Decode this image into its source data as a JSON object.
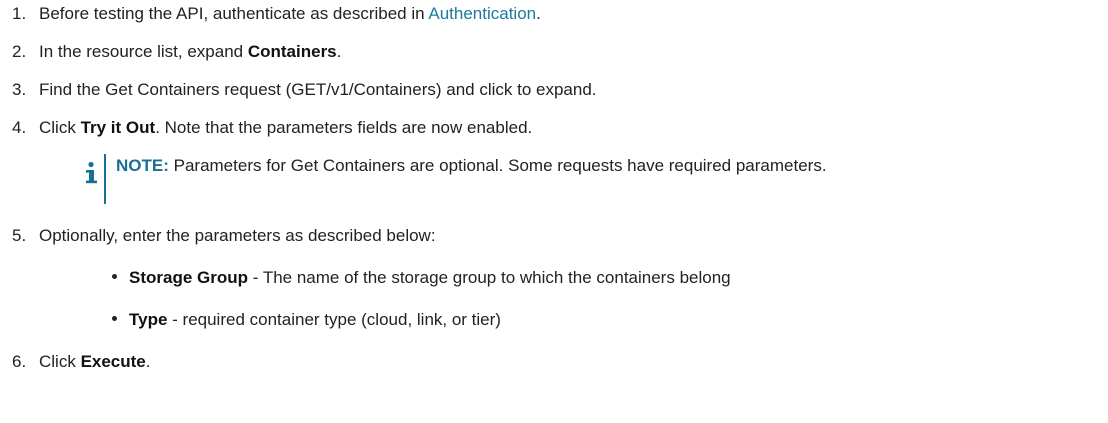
{
  "steps": [
    {
      "num": "1.",
      "pre": "Before testing the API, authenticate as described in ",
      "link": "Authentication",
      "post": "."
    },
    {
      "num": "2.",
      "pre": "In the resource list, expand ",
      "bold": "Containers",
      "post": "."
    },
    {
      "num": "3.",
      "text": "Find the Get Containers request (GET/v1/Containers) and click to expand."
    },
    {
      "num": "4.",
      "pre": "Click ",
      "bold": "Try it Out",
      "post": ". Note that the parameters fields are now enabled."
    },
    {
      "num": "5.",
      "text": "Optionally, enter the parameters as described below:"
    },
    {
      "num": "6.",
      "pre": "Click ",
      "bold": "Execute",
      "post": "."
    }
  ],
  "note": {
    "label": "NOTE:",
    "text": " Parameters for Get Containers are optional. Some requests have required parameters."
  },
  "params": [
    {
      "name": "Storage Group",
      "desc": " - The name of the storage group to which the containers belong"
    },
    {
      "name": "Type",
      "desc": " - required container type (cloud, link, or tier)"
    }
  ],
  "colors": {
    "link": "#1b7a9e",
    "note_accent": "#1b6f95"
  },
  "icons": {
    "note": "info-icon"
  }
}
